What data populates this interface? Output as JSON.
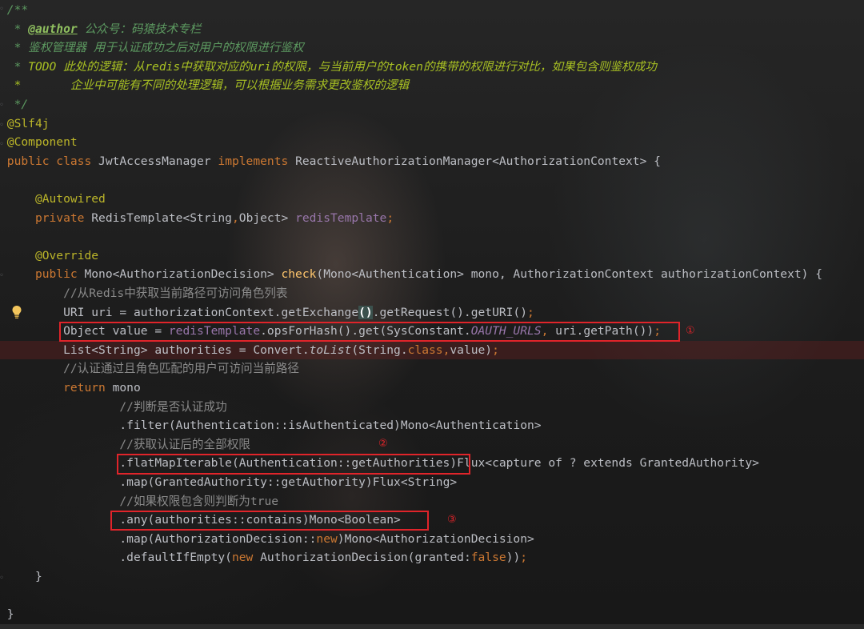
{
  "lines": [
    {
      "indent": "",
      "hl": false,
      "tokens": [
        {
          "c": "doc",
          "t": "/**"
        }
      ]
    },
    {
      "indent": "",
      "hl": false,
      "tokens": [
        {
          "c": "doc",
          "t": " * "
        },
        {
          "c": "tag",
          "t": "@author"
        },
        {
          "c": "doc",
          "t": " 公众号：码猿技术专栏"
        }
      ]
    },
    {
      "indent": "",
      "hl": false,
      "tokens": [
        {
          "c": "doc",
          "t": " * 鉴权管理器 用于认证成功之后对用户的权限进行鉴权"
        }
      ]
    },
    {
      "indent": "",
      "hl": false,
      "tokens": [
        {
          "c": "doc",
          "t": " * "
        },
        {
          "c": "todo",
          "t": "TODO 此处的逻辑：从redis中获取对应的uri的权限，与当前用户的token的携带的权限进行对比，如果包含则鉴权成功"
        }
      ]
    },
    {
      "indent": "",
      "hl": false,
      "tokens": [
        {
          "c": "todo",
          "t": " *       企业中可能有不同的处理逻辑，可以根据业务需求更改鉴权的逻辑"
        }
      ]
    },
    {
      "indent": "",
      "hl": false,
      "tokens": [
        {
          "c": "doc",
          "t": " */"
        }
      ]
    },
    {
      "indent": "",
      "hl": false,
      "tokens": [
        {
          "c": "ann",
          "t": "@Slf4j"
        }
      ]
    },
    {
      "indent": "",
      "hl": false,
      "tokens": [
        {
          "c": "ann",
          "t": "@Component"
        }
      ]
    },
    {
      "indent": "",
      "hl": false,
      "tokens": [
        {
          "c": "kw",
          "t": "public class "
        },
        {
          "c": "txt",
          "t": "JwtAccessManager "
        },
        {
          "c": "kw",
          "t": "implements "
        },
        {
          "c": "txt",
          "t": "ReactiveAuthorizationManager<AuthorizationContext> {"
        }
      ]
    },
    {
      "indent": "",
      "hl": false,
      "tokens": []
    },
    {
      "indent": "    ",
      "hl": false,
      "tokens": [
        {
          "c": "ann",
          "t": "@Autowired"
        }
      ]
    },
    {
      "indent": "    ",
      "hl": false,
      "tokens": [
        {
          "c": "kw",
          "t": "private "
        },
        {
          "c": "txt",
          "t": "RedisTemplate<String"
        },
        {
          "c": "kw",
          "t": ","
        },
        {
          "c": "txt",
          "t": "Object> "
        },
        {
          "c": "field",
          "t": "redisTemplate"
        },
        {
          "c": "kw",
          "t": ";"
        }
      ]
    },
    {
      "indent": "",
      "hl": false,
      "tokens": []
    },
    {
      "indent": "    ",
      "hl": false,
      "tokens": [
        {
          "c": "ann",
          "t": "@Override"
        }
      ]
    },
    {
      "indent": "    ",
      "hl": false,
      "tokens": [
        {
          "c": "kw",
          "t": "public "
        },
        {
          "c": "txt",
          "t": "Mono<AuthorizationDecision> "
        },
        {
          "c": "fn",
          "t": "check"
        },
        {
          "c": "txt",
          "t": "(Mono<Authentication> mono, AuthorizationContext authorizationContext) {"
        }
      ]
    },
    {
      "indent": "        ",
      "hl": false,
      "tokens": [
        {
          "c": "com",
          "t": "//从Redis中获取当前路径可访问角色列表"
        }
      ]
    },
    {
      "indent": "        ",
      "hl": false,
      "tokens": [
        {
          "c": "txt",
          "t": "URI uri = authorizationContext.getExchange"
        },
        {
          "c": "brace",
          "t": "()"
        },
        {
          "c": "txt",
          "t": ".getRequest().getURI()"
        },
        {
          "c": "kw",
          "t": ";"
        }
      ]
    },
    {
      "indent": "        ",
      "hl": false,
      "tokens": [
        {
          "c": "txt",
          "t": "Object value = "
        },
        {
          "c": "field",
          "t": "redisTemplate"
        },
        {
          "c": "txt",
          "t": ".opsForHash().get(SysConstant."
        },
        {
          "c": "const",
          "t": "OAUTH_URLS"
        },
        {
          "c": "kw",
          "t": ", "
        },
        {
          "c": "txt",
          "t": "uri.getPath())"
        },
        {
          "c": "kw",
          "t": ";"
        }
      ]
    },
    {
      "indent": "        ",
      "hl": true,
      "tokens": [
        {
          "c": "txt",
          "t": "List<String> authorities = Convert."
        },
        {
          "c": "it",
          "t": "toList"
        },
        {
          "c": "txt",
          "t": "(String."
        },
        {
          "c": "kw",
          "t": "class,"
        },
        {
          "c": "txt",
          "t": "value)"
        },
        {
          "c": "kw",
          "t": ";"
        }
      ]
    },
    {
      "indent": "        ",
      "hl": false,
      "tokens": [
        {
          "c": "com",
          "t": "//认证通过且角色匹配的用户可访问当前路径"
        }
      ]
    },
    {
      "indent": "        ",
      "hl": false,
      "tokens": [
        {
          "c": "kw",
          "t": "return "
        },
        {
          "c": "txt",
          "t": "mono"
        }
      ]
    },
    {
      "indent": "                ",
      "hl": false,
      "tokens": [
        {
          "c": "com",
          "t": "//判断是否认证成功"
        }
      ]
    },
    {
      "indent": "                ",
      "hl": false,
      "tokens": [
        {
          "c": "txt",
          "t": ".filter(Authentication::isAuthenticated)"
        },
        {
          "c": "hint",
          "t": "Mono<Authentication>"
        }
      ]
    },
    {
      "indent": "                ",
      "hl": false,
      "tokens": [
        {
          "c": "com",
          "t": "//获取认证后的全部权限"
        }
      ]
    },
    {
      "indent": "                ",
      "hl": false,
      "tokens": [
        {
          "c": "txt",
          "t": ".flatMapIterable(Authentication::getAuthorities)"
        },
        {
          "c": "hint",
          "t": "Flux<capture of ? extends GrantedAuthority>"
        }
      ]
    },
    {
      "indent": "                ",
      "hl": false,
      "tokens": [
        {
          "c": "txt",
          "t": ".map(GrantedAuthority::getAuthority)"
        },
        {
          "c": "hint",
          "t": "Flux<String>"
        }
      ]
    },
    {
      "indent": "                ",
      "hl": false,
      "tokens": [
        {
          "c": "com",
          "t": "//如果权限包含则判断为true"
        }
      ]
    },
    {
      "indent": "                ",
      "hl": false,
      "tokens": [
        {
          "c": "txt",
          "t": ".any(authorities::contains)"
        },
        {
          "c": "hint",
          "t": "Mono<Boolean>"
        }
      ]
    },
    {
      "indent": "                ",
      "hl": false,
      "tokens": [
        {
          "c": "txt",
          "t": ".map(AuthorizationDecision::"
        },
        {
          "c": "kw",
          "t": "new"
        },
        {
          "c": "txt",
          "t": ")"
        },
        {
          "c": "hint",
          "t": "Mono<AuthorizationDecision>"
        }
      ]
    },
    {
      "indent": "                ",
      "hl": false,
      "tokens": [
        {
          "c": "txt",
          "t": ".defaultIfEmpty("
        },
        {
          "c": "kw",
          "t": "new "
        },
        {
          "c": "txt",
          "t": "AuthorizationDecision("
        },
        {
          "c": "pname",
          "t": "granted:"
        },
        {
          "c": "kw",
          "t": "false"
        },
        {
          "c": "txt",
          "t": "))"
        },
        {
          "c": "kw",
          "t": ";"
        }
      ]
    },
    {
      "indent": "    ",
      "hl": false,
      "tokens": [
        {
          "c": "txt",
          "t": "}"
        }
      ]
    },
    {
      "indent": "",
      "hl": false,
      "tokens": []
    },
    {
      "indent": "",
      "hl": false,
      "tokens": [
        {
          "c": "txt",
          "t": "}"
        }
      ]
    }
  ],
  "annotations": {
    "one": "①",
    "two": "②",
    "three": "③"
  },
  "colors": {
    "box": "#e0242a",
    "keyword": "#cc7832",
    "annotation": "#bbb529",
    "method": "#ffc66d",
    "field": "#9876aa",
    "doc_comment": "#5c9960",
    "comment": "#8a8a8a"
  },
  "icons": {
    "intention": "lightbulb-icon"
  }
}
